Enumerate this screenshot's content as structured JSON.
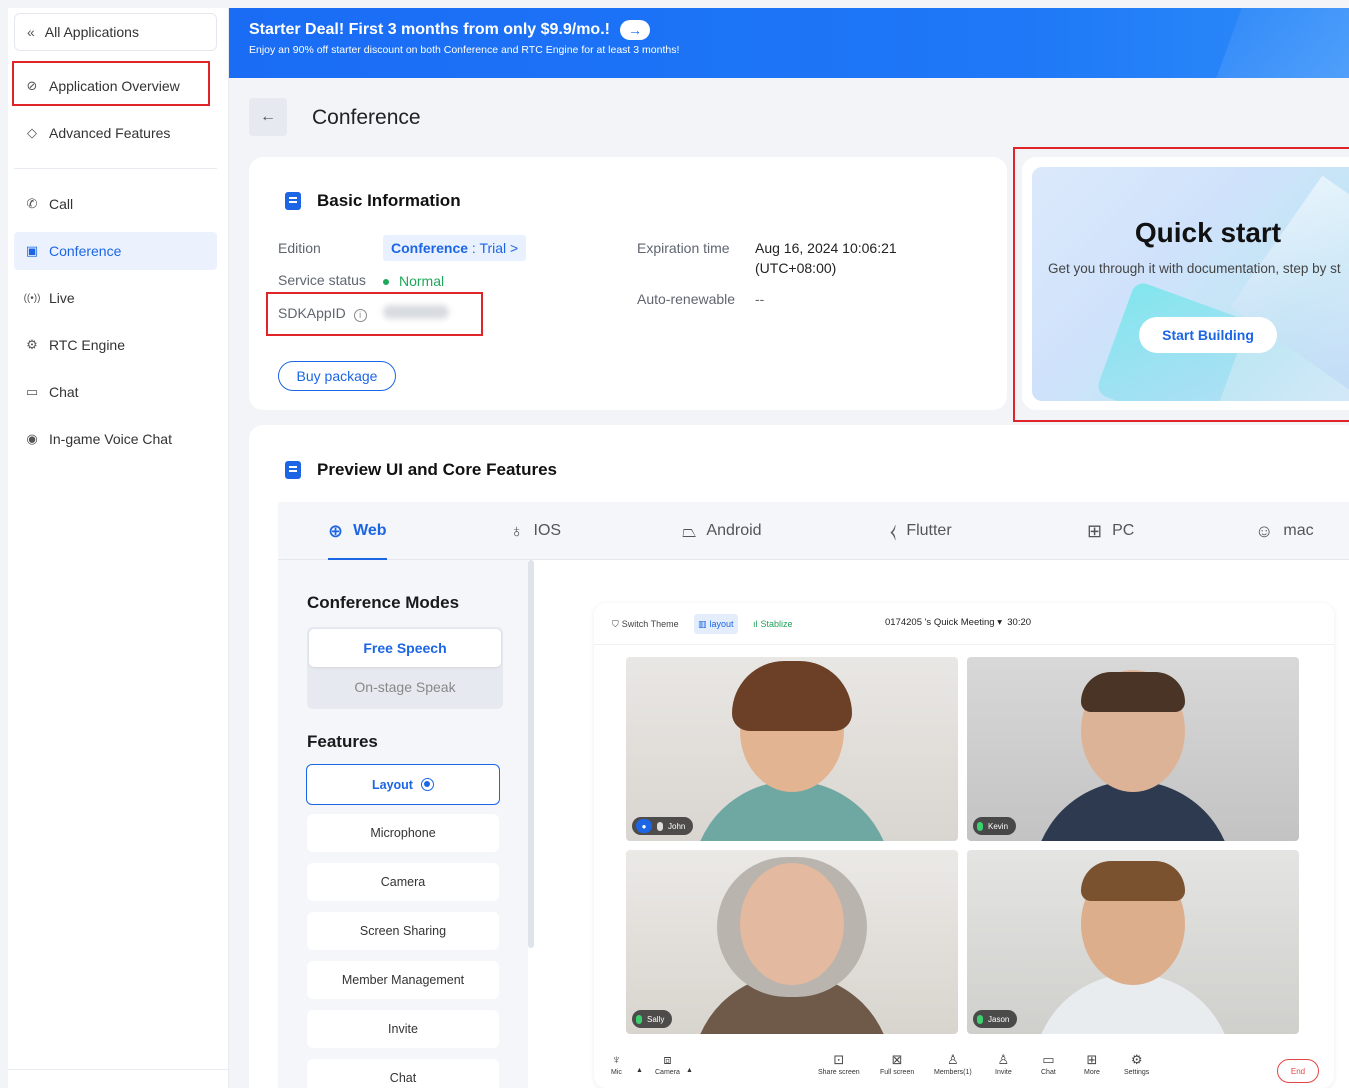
{
  "sidebar": {
    "all_apps": "All Applications",
    "items": [
      {
        "label": "Application Overview",
        "icon": "compass-icon"
      },
      {
        "label": "Advanced Features",
        "icon": "diamond-icon"
      },
      {
        "label": "Call",
        "icon": "phone-icon"
      },
      {
        "label": "Conference",
        "icon": "conference-icon"
      },
      {
        "label": "Live",
        "icon": "broadcast-icon"
      },
      {
        "label": "RTC Engine",
        "icon": "engine-icon"
      },
      {
        "label": "Chat",
        "icon": "chat-icon"
      },
      {
        "label": "In-game Voice Chat",
        "icon": "gamepad-icon"
      }
    ],
    "active": "Conference"
  },
  "banner": {
    "title": "Starter Deal! First 3 months from only $9.9/mo.!",
    "subtitle": "Enjoy an 90% off starter discount on both Conference and RTC Engine for at least 3 months!",
    "color": "#1a6cf5"
  },
  "page": {
    "title": "Conference"
  },
  "basic_info": {
    "title": "Basic Information",
    "edition_label": "Edition",
    "edition_value": "Conference",
    "edition_suffix": ": Trial >",
    "service_status_label": "Service status",
    "service_status_value": "Normal",
    "sdkappid_label": "SDKAppID",
    "expiration_label": "Expiration time",
    "expiration_value": "Aug 16, 2024 10:06:21",
    "expiration_tz": "(UTC+08:00)",
    "auto_renew_label": "Auto-renewable",
    "auto_renew_value": "--",
    "buy_label": "Buy package"
  },
  "quick_start": {
    "title": "Quick start",
    "description": "Get you through it with documentation, step by st",
    "button": "Start Building"
  },
  "preview": {
    "title": "Preview UI and Core Features",
    "tabs": [
      {
        "label": "Web",
        "icon": "globe-icon"
      },
      {
        "label": "IOS",
        "icon": "apple-icon"
      },
      {
        "label": "Android",
        "icon": "android-icon"
      },
      {
        "label": "Flutter",
        "icon": "flutter-icon"
      },
      {
        "label": "PC",
        "icon": "windows-icon"
      },
      {
        "label": "mac",
        "icon": "mac-icon"
      }
    ],
    "active_tab": "Web",
    "modes_title": "Conference Modes",
    "modes": [
      "Free Speech",
      "On-stage Speak"
    ],
    "selected_mode": "Free Speech",
    "features_title": "Features",
    "features": [
      "Layout",
      "Microphone",
      "Camera",
      "Screen Sharing",
      "Member Management",
      "Invite",
      "Chat"
    ],
    "selected_feature": "Layout"
  },
  "meeting": {
    "switch_theme": "Switch Theme",
    "layout": "layout",
    "stabilize": "Stablize",
    "title": "0174205 's Quick Meeting",
    "timer": "30:20",
    "participants": [
      "John",
      "Kevin",
      "Sally",
      "Jason"
    ],
    "toolbar": [
      "Mic",
      "Camera",
      "Share screen",
      "Full screen",
      "Members(1)",
      "Invite",
      "Chat",
      "More",
      "Settings"
    ],
    "end": "End"
  },
  "accent_color": "#1c66e5",
  "highlight_color": "#e1232a"
}
